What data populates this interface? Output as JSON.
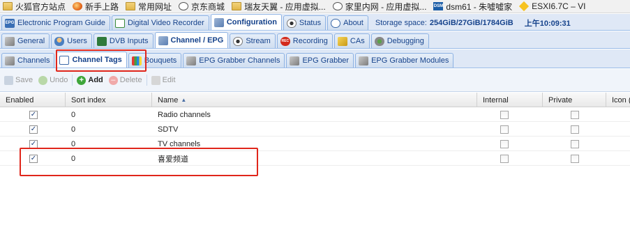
{
  "bookmarks": [
    {
      "label": "火狐官方站点",
      "icon": "folder-icon"
    },
    {
      "label": "新手上路",
      "icon": "firefox-icon"
    },
    {
      "label": "常用网址",
      "icon": "folder-icon"
    },
    {
      "label": "京东商城",
      "icon": "globe-icon"
    },
    {
      "label": "瑞友天翼 - 应用虚拟...",
      "icon": "folder-icon"
    },
    {
      "label": "家里内网 - 应用虚拟...",
      "icon": "globe-icon"
    },
    {
      "label": "dsm61 - 朱噓噓家",
      "icon": "dsm-icon"
    },
    {
      "label": "ESXI6.7C – VI",
      "icon": "diamond-icon"
    }
  ],
  "top_tabs": [
    {
      "label": "Electronic Program Guide"
    },
    {
      "label": "Digital Video Recorder"
    },
    {
      "label": "Configuration"
    },
    {
      "label": "Status"
    },
    {
      "label": "About"
    }
  ],
  "storage": {
    "label": "Storage space:",
    "value": "254GiB/27GiB/1784GiB",
    "time": "上午10:09:31"
  },
  "config_tabs": [
    {
      "label": "General"
    },
    {
      "label": "Users"
    },
    {
      "label": "DVB Inputs"
    },
    {
      "label": "Channel / EPG"
    },
    {
      "label": "Stream"
    },
    {
      "label": "Recording"
    },
    {
      "label": "CAs"
    },
    {
      "label": "Debugging"
    }
  ],
  "channel_tabs": [
    {
      "label": "Channels"
    },
    {
      "label": "Channel Tags"
    },
    {
      "label": "Bouquets"
    },
    {
      "label": "EPG Grabber Channels"
    },
    {
      "label": "EPG Grabber"
    },
    {
      "label": "EPG Grabber Modules"
    }
  ],
  "toolbar": {
    "save": "Save",
    "undo": "Undo",
    "add": "Add",
    "delete": "Delete",
    "edit": "Edit"
  },
  "grid": {
    "columns": {
      "enabled": "Enabled",
      "sort_index": "Sort index",
      "name": "Name",
      "internal": "Internal",
      "private": "Private",
      "icon": "Icon (f"
    },
    "sort": "ascending",
    "rows": [
      {
        "enabled": true,
        "sort_index": "0",
        "name": "Radio channels",
        "internal": false,
        "private": false
      },
      {
        "enabled": true,
        "sort_index": "0",
        "name": "SDTV",
        "internal": false,
        "private": false
      },
      {
        "enabled": true,
        "sort_index": "0",
        "name": "TV channels",
        "internal": false,
        "private": false
      },
      {
        "enabled": true,
        "sort_index": "0",
        "name": "喜爱频道",
        "internal": false,
        "private": false
      }
    ]
  },
  "colors": {
    "accent": "#15428b",
    "tab_bg": "#dfe8f6",
    "highlight": "#e0261b"
  }
}
